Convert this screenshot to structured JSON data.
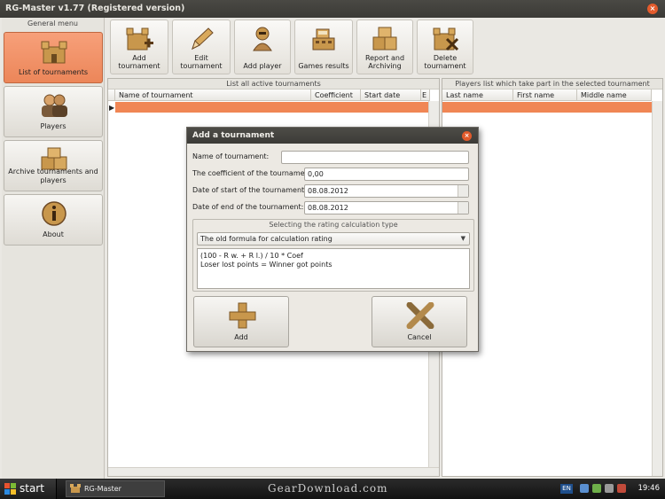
{
  "window": {
    "title": "RG-Master v1.77 (Registered version)"
  },
  "sidebar": {
    "header": "General menu",
    "items": [
      {
        "label": "List of tournaments",
        "icon": "castle-icon",
        "active": true
      },
      {
        "label": "Players",
        "icon": "players-icon",
        "active": false
      },
      {
        "label": "Archive tournaments and players",
        "icon": "archive-boxes-icon",
        "active": false
      },
      {
        "label": "About",
        "icon": "info-icon",
        "active": false
      }
    ]
  },
  "toolbar": {
    "buttons": [
      {
        "label": "Add tournament",
        "icon": "castle-add-icon"
      },
      {
        "label": "Edit tournament",
        "icon": "pencil-icon"
      },
      {
        "label": "Add player",
        "icon": "knight-player-icon"
      },
      {
        "label": "Games results",
        "icon": "cash-register-icon"
      },
      {
        "label": "Report and Archiving",
        "icon": "boxes-icon"
      },
      {
        "label": "Delete tournament",
        "icon": "castle-delete-icon"
      }
    ]
  },
  "tournaments_panel": {
    "title": "List all active tournaments",
    "columns": [
      "Name of tournament",
      "Coefficient",
      "Start date",
      "E"
    ]
  },
  "players_panel": {
    "title": "Players list which take part in the selected tournament",
    "columns": [
      "Last name",
      "First name",
      "Middle name"
    ]
  },
  "dialog": {
    "title": "Add a tournament",
    "name_label": "Name of tournament:",
    "name_value": "",
    "coef_label": "The coefficient of the tournament:",
    "coef_value": "0,00",
    "start_label": "Date of start of the tournament:",
    "start_value": "08.08.2012",
    "end_label": "Date of end of the tournament:",
    "end_value": "08.08.2012",
    "rating_group_title": "Selecting the rating calculation type",
    "rating_selected": "The old formula for calculation rating",
    "formula_line1": "(100 - R w. + R l.) / 10 * Coef",
    "formula_line2": "Loser lost points = Winner got points",
    "add_label": "Add",
    "cancel_label": "Cancel"
  },
  "taskbar": {
    "start_label": "start",
    "task_label": "RG-Master",
    "watermark": "GearDownload.com",
    "lang": "EN",
    "clock": "19:46"
  },
  "colors": {
    "accent": "#f08654",
    "titlebar": "#3c3b37",
    "close": "#e45b2c"
  }
}
